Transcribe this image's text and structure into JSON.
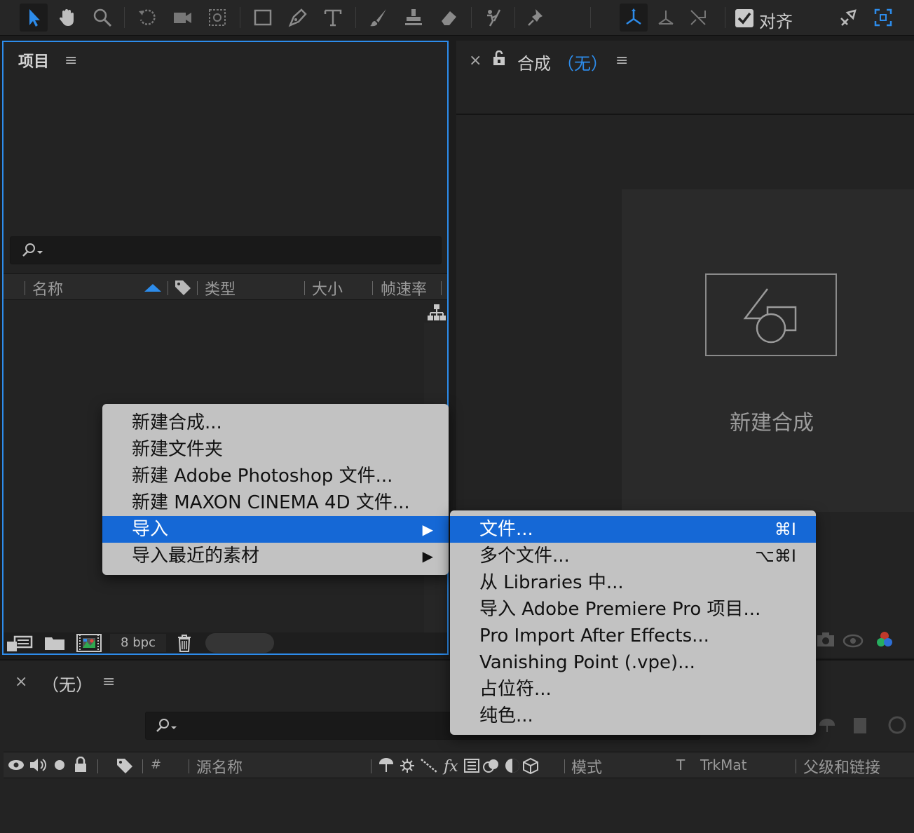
{
  "toolbar": {
    "align_label": "对齐",
    "align_checked": true,
    "accent": "#2d8ceb"
  },
  "project_panel": {
    "title": "项目",
    "menu_glyph": "≡",
    "columns": [
      "名称",
      "类型",
      "大小",
      "帧速率"
    ],
    "footer": {
      "bpc": "8 bpc"
    }
  },
  "comp_panel": {
    "close_glyph": "×",
    "title": "合成",
    "comp_name": "（无）",
    "menu_glyph": "≡",
    "new_comp_label": "新建合成"
  },
  "timeline": {
    "close_glyph": "×",
    "title": "（无）",
    "menu_glyph": "≡",
    "columns": {
      "hash": "#",
      "source_name": "源名称",
      "mode": "模式",
      "t": "T",
      "trkmat": "TrkMat",
      "parent": "父级和链接"
    }
  },
  "context_menu": {
    "items": [
      {
        "label": "新建合成...",
        "submenu": false
      },
      {
        "label": "新建文件夹",
        "submenu": false
      },
      {
        "label": "新建 Adobe Photoshop 文件...",
        "submenu": false
      },
      {
        "label": "新建 MAXON CINEMA 4D 文件...",
        "submenu": false
      },
      {
        "label": "导入",
        "submenu": true,
        "selected": true
      },
      {
        "label": "导入最近的素材",
        "submenu": true
      }
    ],
    "arrow_glyph": "▶"
  },
  "import_submenu": {
    "items": [
      {
        "label": "文件...",
        "shortcut": "⌘I",
        "selected": true
      },
      {
        "label": "多个文件...",
        "shortcut": "⌥⌘I"
      },
      {
        "label": "从 Libraries 中...",
        "shortcut": ""
      },
      {
        "label": "导入 Adobe Premiere Pro 项目...",
        "shortcut": ""
      },
      {
        "label": "Pro Import After Effects...",
        "shortcut": ""
      },
      {
        "label": "Vanishing Point (.vpe)...",
        "shortcut": ""
      },
      {
        "label": "占位符...",
        "shortcut": ""
      },
      {
        "label": "纯色...",
        "shortcut": ""
      }
    ],
    "selection_color": "#1568d6"
  }
}
